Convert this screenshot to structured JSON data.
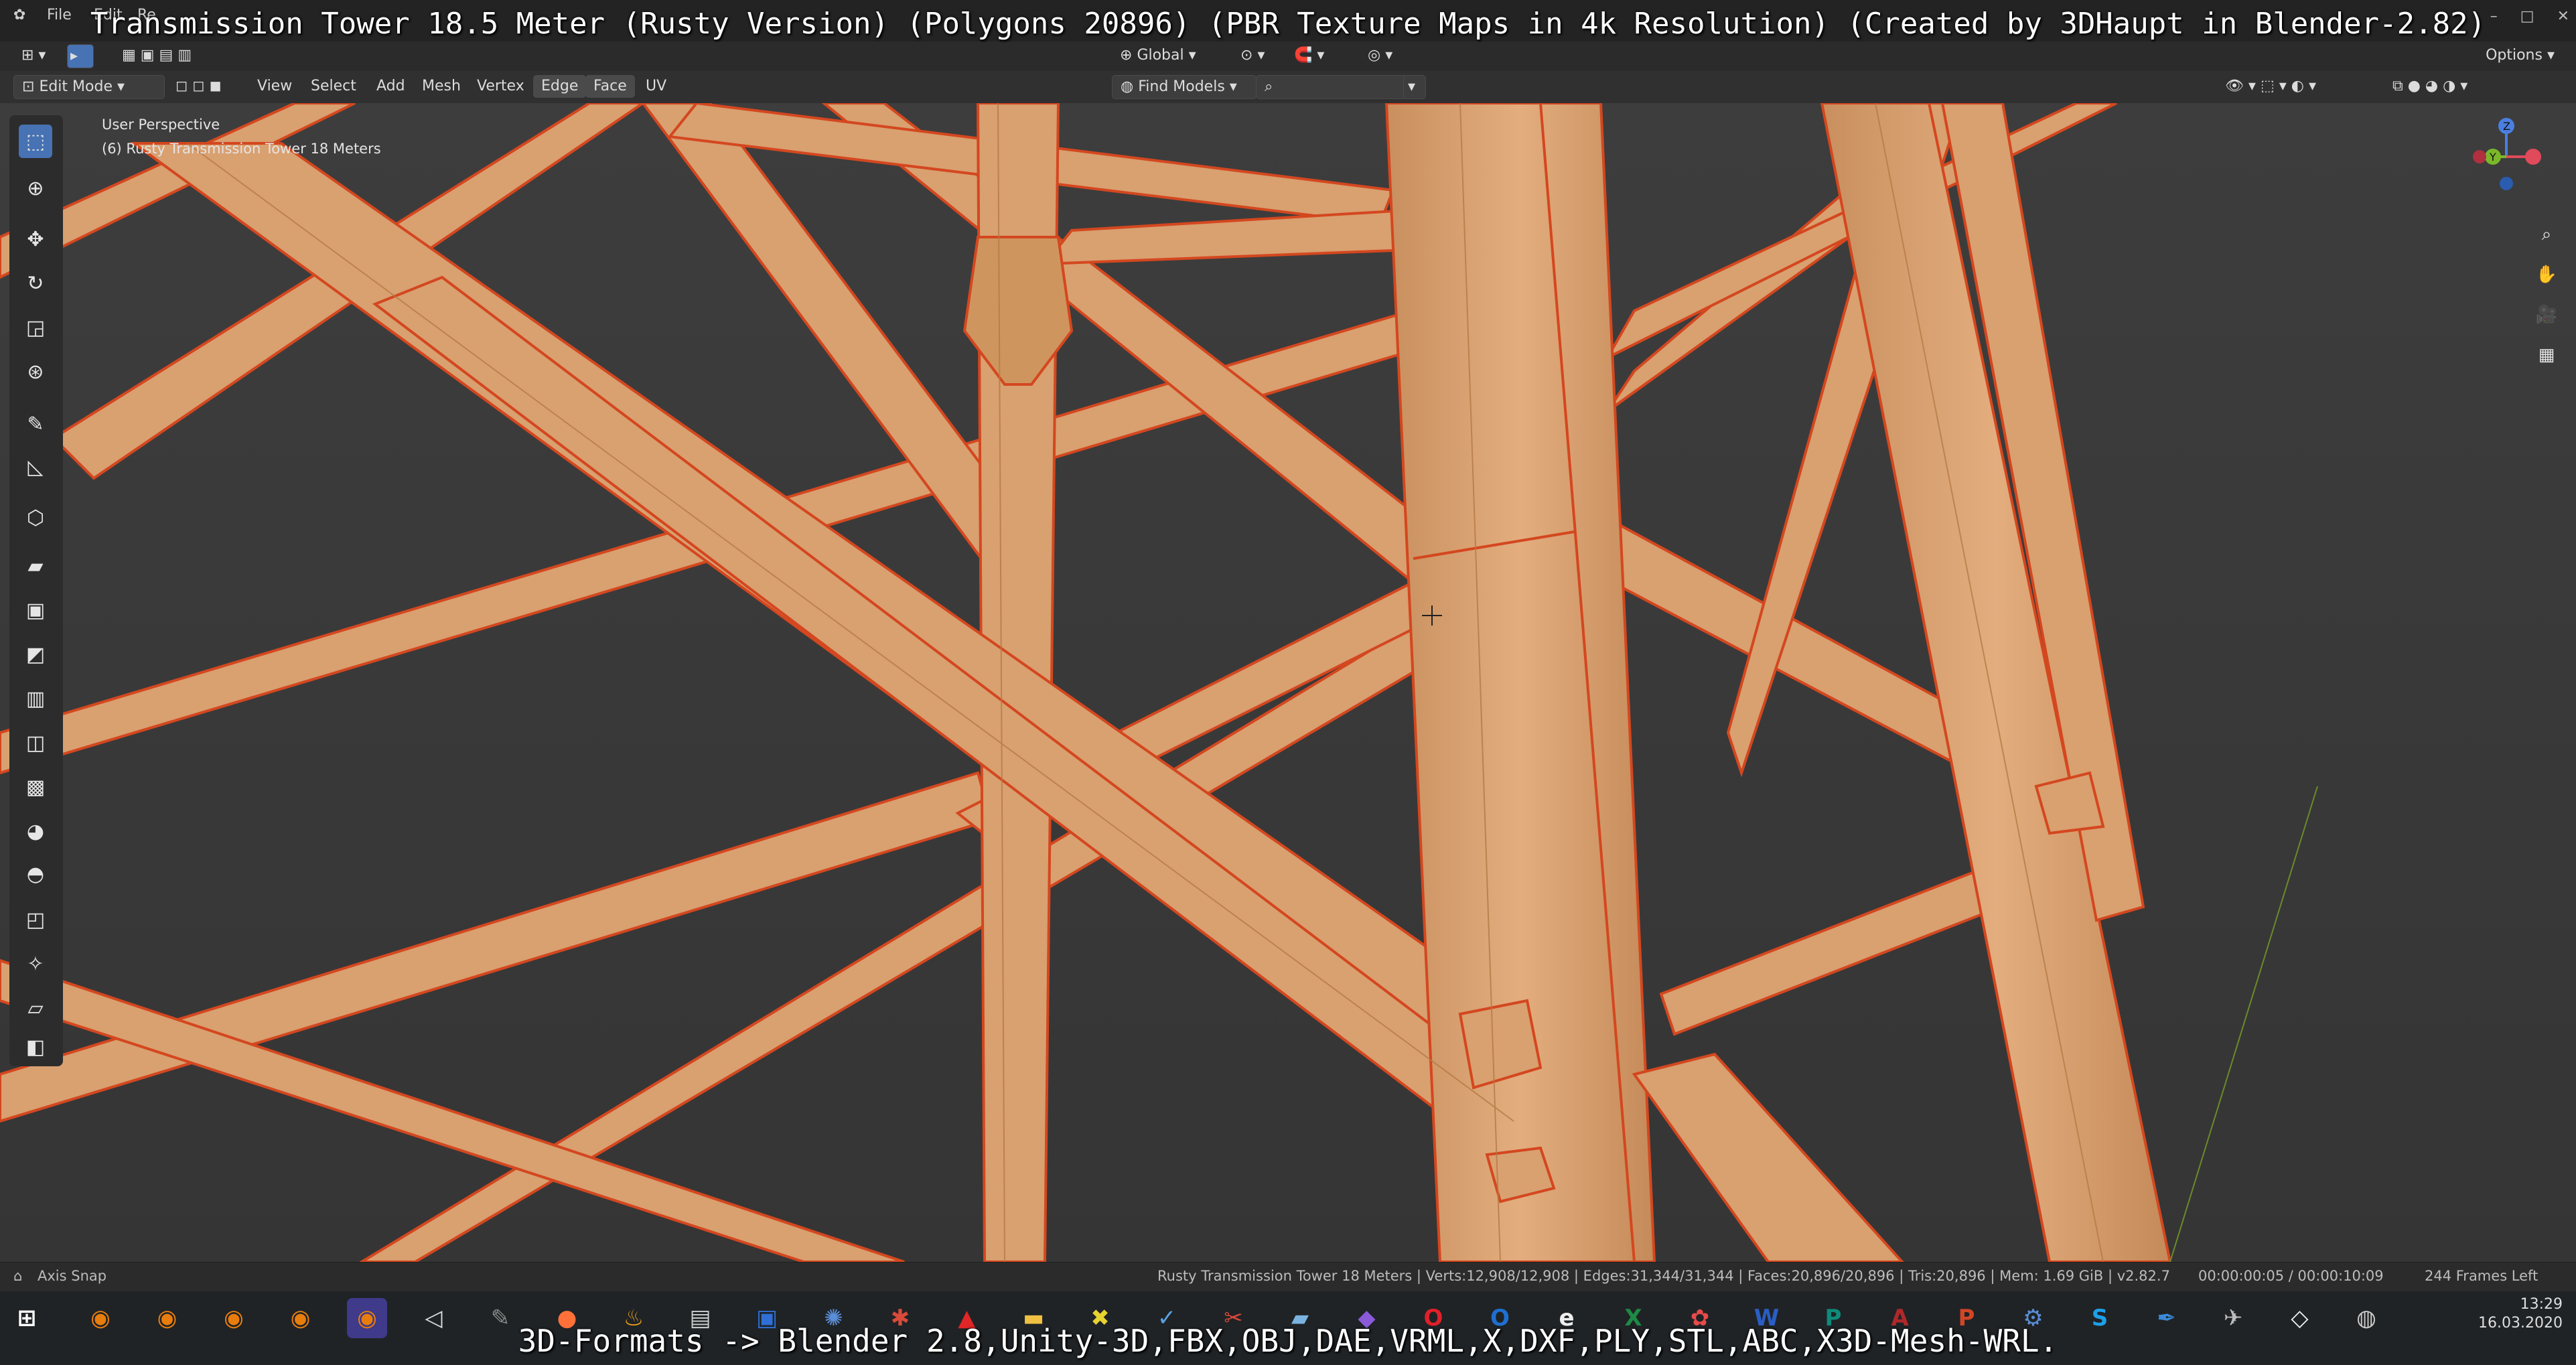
{
  "caption": "Transmission Tower 18.5 Meter (Rusty Version) (Polygons 20896) (PBR Texture Maps in 4k Resolution) (Created by 3DHaupt in Blender-2.82)",
  "bottom_caption": "3D-Formats -> Blender 2.8,Unity-3D,FBX,OBJ,DAE,VRML,X,DXF,PLY,STL,ABC,X3D-Mesh-WRL.",
  "topbar": {
    "menus": [
      "File",
      "Edit",
      "Re"
    ],
    "window_controls": [
      "–",
      "□",
      "✕"
    ]
  },
  "header": {
    "mode": "Edit Mode",
    "menus": [
      "View",
      "Select",
      "Add",
      "Mesh",
      "Vertex",
      "Edge",
      "Face",
      "UV"
    ],
    "orientation": "Global",
    "search_label": "Find Models",
    "options_label": "Options"
  },
  "viewport": {
    "perspective": "User Perspective",
    "object_name": "(6) Rusty Transmission Tower 18 Meters",
    "gizmo_axes": [
      "Z",
      "Y",
      "X"
    ]
  },
  "status": {
    "left": "Axis Snap",
    "stats": "Rusty Transmission Tower 18 Meters | Verts:12,908/12,908 | Edges:31,344/31,344 | Faces:20,896/20,896 | Tris:20,896 | Mem: 1.69 GiB | v2.82.7",
    "time": "00:00:00:05 / 00:00:10:09",
    "frames": "244 Frames Left"
  },
  "taskbar": {
    "clock_time": "13:29",
    "clock_date": "16.03.2020",
    "apps": [
      {
        "icon": "blender-icon",
        "glyph": "◉",
        "color": "#e87d0d"
      },
      {
        "icon": "blender-icon",
        "glyph": "◉",
        "color": "#e87d0d"
      },
      {
        "icon": "blender-icon",
        "glyph": "◉",
        "color": "#e87d0d"
      },
      {
        "icon": "blender-icon",
        "glyph": "◉",
        "color": "#e87d0d"
      },
      {
        "icon": "blender-active-icon",
        "glyph": "◉",
        "color": "#e87d0d"
      },
      {
        "icon": "unity-icon",
        "glyph": "◁",
        "color": "#dddddd"
      },
      {
        "icon": "gimp-icon",
        "glyph": "✎",
        "color": "#8c8c8c"
      },
      {
        "icon": "firefox-icon",
        "glyph": "●",
        "color": "#ff7139"
      },
      {
        "icon": "flame-icon",
        "glyph": "♨",
        "color": "#f2a51a"
      },
      {
        "icon": "terminal-icon",
        "glyph": "▤",
        "color": "#cfcfcf"
      },
      {
        "icon": "save-icon",
        "glyph": "▣",
        "color": "#2f6fd6"
      },
      {
        "icon": "network-icon",
        "glyph": "✺",
        "color": "#5a8ed8"
      },
      {
        "icon": "bug-icon",
        "glyph": "✱",
        "color": "#d84a3a"
      },
      {
        "icon": "pdf-icon",
        "glyph": "▲",
        "color": "#e02626"
      },
      {
        "icon": "folder-icon",
        "glyph": "▬",
        "color": "#f0c042"
      },
      {
        "icon": "xnview-icon",
        "glyph": "✖",
        "color": "#e8d230"
      },
      {
        "icon": "chart-icon",
        "glyph": "✓",
        "color": "#5aa0e0"
      },
      {
        "icon": "tool-icon",
        "glyph": "✂",
        "color": "#d84a3a"
      },
      {
        "icon": "paint-icon",
        "glyph": "▰",
        "color": "#7ab3e0"
      },
      {
        "icon": "gem-icon",
        "glyph": "◆",
        "color": "#8a5ad8"
      },
      {
        "icon": "opera-icon",
        "glyph": "O",
        "color": "#e0202a"
      },
      {
        "icon": "outlook-icon",
        "glyph": "O",
        "color": "#1f6fd0"
      },
      {
        "icon": "edge-icon",
        "glyph": "e",
        "color": "#eeeeee"
      },
      {
        "icon": "excel-icon",
        "glyph": "X",
        "color": "#1e8a45"
      },
      {
        "icon": "vector-icon",
        "glyph": "✿",
        "color": "#e84a4a"
      },
      {
        "icon": "word-icon",
        "glyph": "W",
        "color": "#2a5ec4"
      },
      {
        "icon": "publisher-icon",
        "glyph": "P",
        "color": "#0f8a7a"
      },
      {
        "icon": "access-icon",
        "glyph": "A",
        "color": "#b0282a"
      },
      {
        "icon": "powerpoint-icon",
        "glyph": "P",
        "color": "#d24626"
      },
      {
        "icon": "settings-icon",
        "glyph": "⚙",
        "color": "#5a8ed8"
      },
      {
        "icon": "skype-icon",
        "glyph": "S",
        "color": "#1ea0e8"
      },
      {
        "icon": "pen-icon",
        "glyph": "✒",
        "color": "#3a8ad8"
      },
      {
        "icon": "plane-icon",
        "glyph": "✈",
        "color": "#bbbbbb"
      },
      {
        "icon": "unity3d-icon",
        "glyph": "◇",
        "color": "#eeeeee"
      },
      {
        "icon": "disc-icon",
        "glyph": "◍",
        "color": "#cccccc"
      }
    ]
  }
}
